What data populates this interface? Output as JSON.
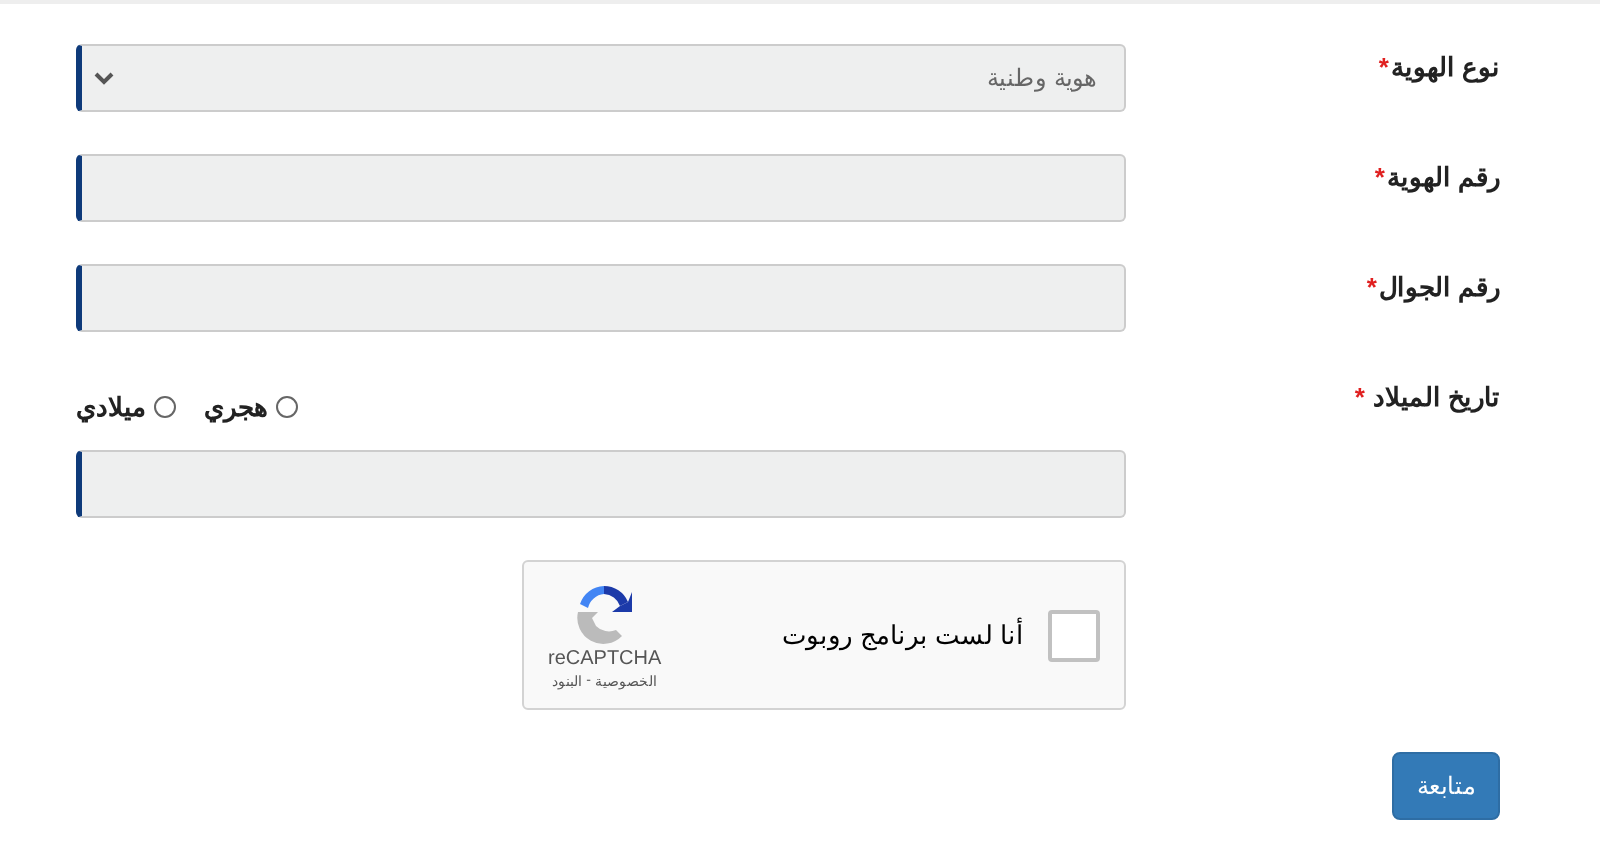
{
  "fields": [
    {
      "kind": "select",
      "label": "نوع الهوية",
      "required_mark": "*",
      "value": "هوية وطنية"
    },
    {
      "kind": "input",
      "label": "رقم الهوية",
      "required_mark": "*"
    },
    {
      "kind": "input",
      "label": "رقم الجوال",
      "required_mark": "*"
    },
    {
      "kind": "date",
      "label": "تاريخ الميلاد",
      "required_mark": "*",
      "options": [
        {
          "label": "هجري",
          "selected": false
        },
        {
          "label": "ميلادي",
          "selected": false
        }
      ]
    }
  ],
  "captcha": {
    "checkbox_label": "أنا لست برنامج روبوت",
    "checked": false,
    "brand": "reCAPTCHA",
    "links": [
      "الخصوصية",
      "البنود"
    ],
    "separator": "-"
  },
  "submit": {
    "label": "متابعة"
  }
}
